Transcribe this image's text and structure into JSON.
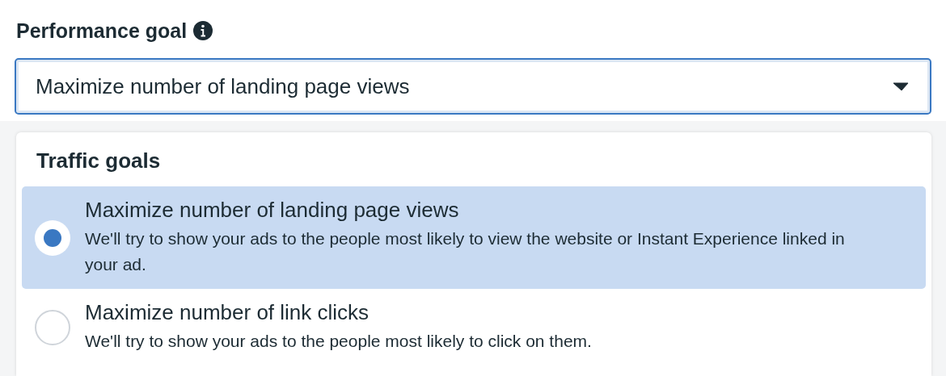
{
  "field": {
    "label": "Performance goal",
    "value": "Maximize number of landing page views"
  },
  "dropdown": {
    "heading": "Traffic goals",
    "options": [
      {
        "title": "Maximize number of landing page views",
        "description": "We'll try to show your ads to the people most likely to view the website or Instant Experience linked in your ad.",
        "selected": true
      },
      {
        "title": "Maximize number of link clicks",
        "description": "We'll try to show your ads to the people most likely to click on them.",
        "selected": false
      }
    ]
  }
}
